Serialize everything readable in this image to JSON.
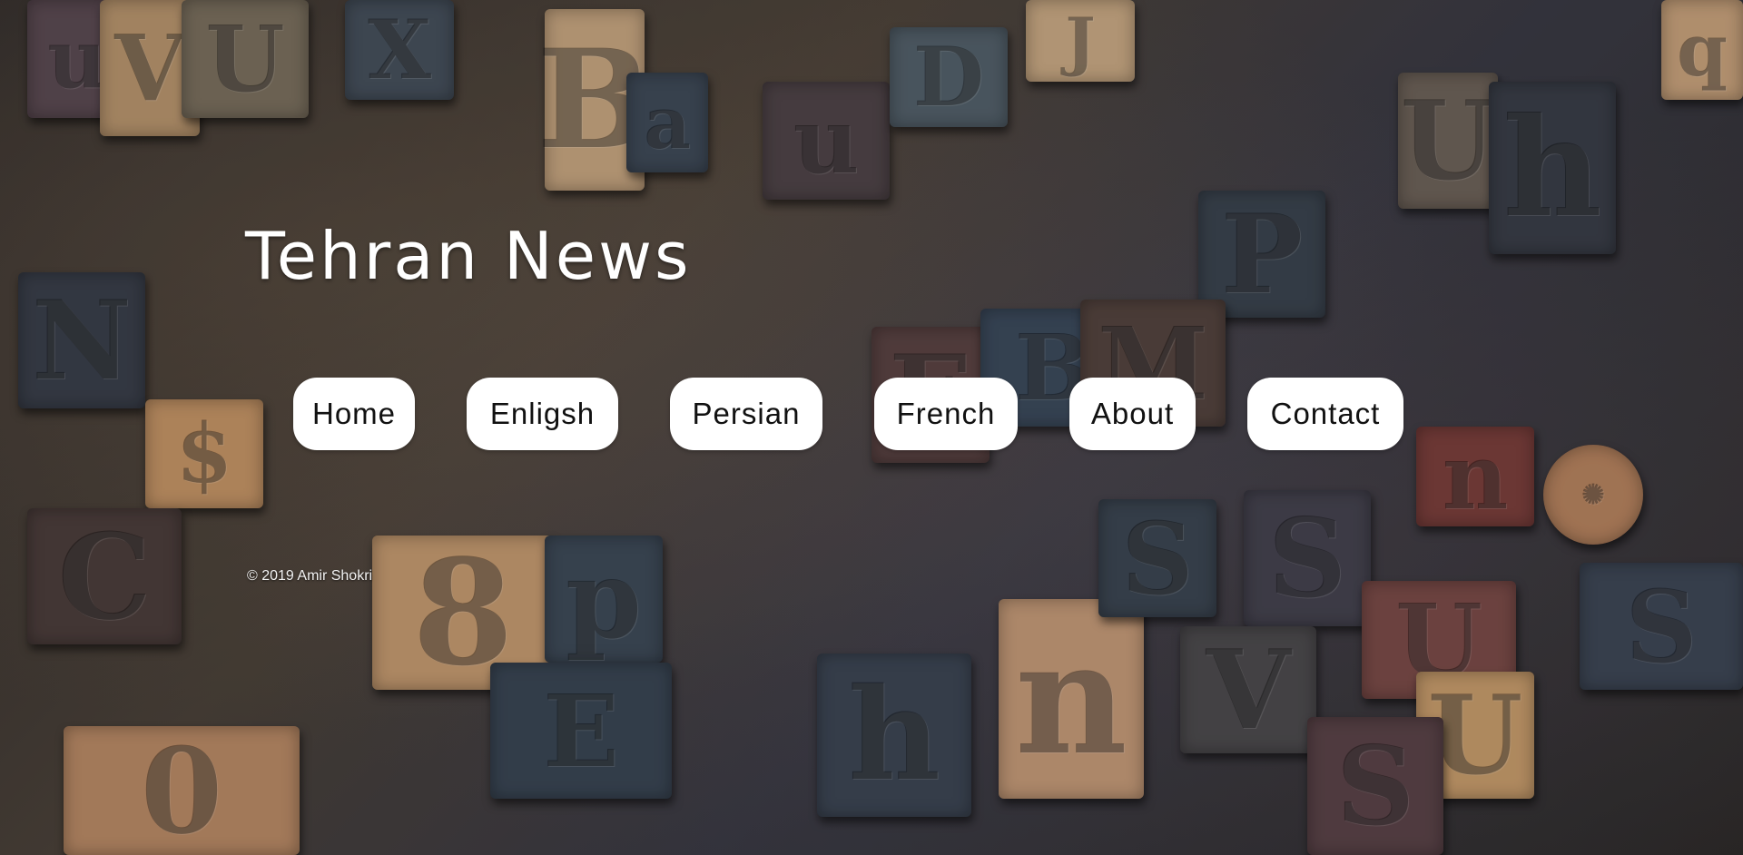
{
  "site": {
    "title": "Tehran News"
  },
  "nav": {
    "items": [
      {
        "id": "home",
        "label": "Home"
      },
      {
        "id": "english",
        "label": "Enligsh"
      },
      {
        "id": "persian",
        "label": "Persian"
      },
      {
        "id": "french",
        "label": "French"
      },
      {
        "id": "about",
        "label": "About"
      },
      {
        "id": "contact",
        "label": "Contact"
      }
    ]
  },
  "footer": {
    "copyright": "© 2019 Amir Shokri"
  },
  "theme": {
    "title_color": "#ffffff",
    "button_bg": "#ffffff",
    "button_text": "#111111",
    "background_image": "letterpress wood type blocks"
  }
}
